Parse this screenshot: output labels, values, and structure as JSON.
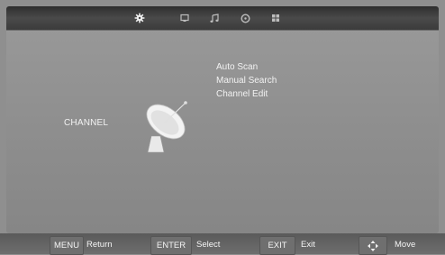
{
  "top_tabs": [
    {
      "icon": "gear-icon"
    },
    {
      "icon": "picture-icon"
    },
    {
      "icon": "music-note-icon"
    },
    {
      "icon": "clock-icon"
    },
    {
      "icon": "grid-icon"
    }
  ],
  "menu": {
    "section_title": "CHANNEL",
    "items": [
      "Auto Scan",
      "Manual Search",
      "Channel Edit"
    ]
  },
  "footer": {
    "keys": [
      {
        "key": "MENU",
        "action": "Return"
      },
      {
        "key": "ENTER",
        "action": "Select"
      },
      {
        "key": "EXIT",
        "action": "Exit"
      },
      {
        "key": "move-arrows-icon",
        "action": "Move"
      }
    ]
  }
}
